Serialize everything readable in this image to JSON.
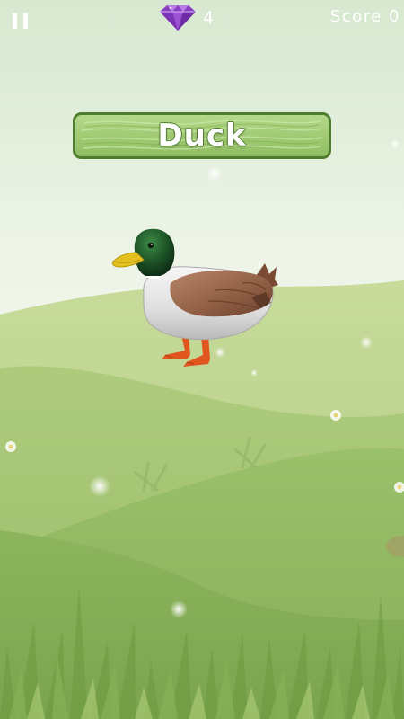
{
  "hud": {
    "gem_icon": "gem-icon",
    "gem_count": "4",
    "score_text": "Score 0",
    "pause_icon": "pause-icon"
  },
  "banner": {
    "word": "Duck"
  },
  "scene": {
    "subject_icon": "duck-icon"
  },
  "colors": {
    "sky_top": "#d9e9d2",
    "sky_mid": "#eef4e8",
    "hill_far": "#b7cf86",
    "hill_mid": "#9dc06a",
    "hill_near": "#8fb65b",
    "banner_fill": "#a6cf7a",
    "banner_border": "#4e7d2b",
    "gem": "#8a3fc3"
  }
}
